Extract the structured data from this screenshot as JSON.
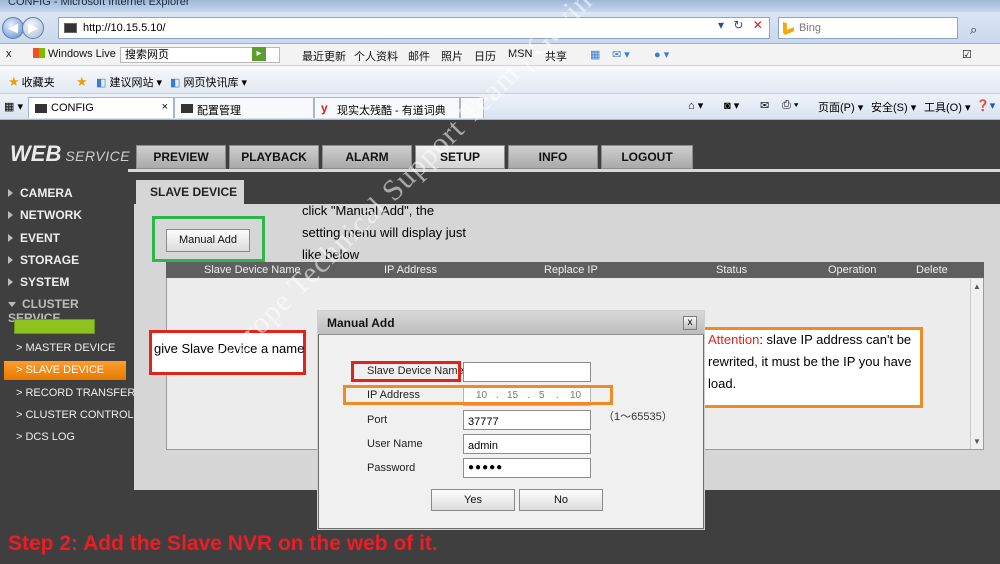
{
  "browser": {
    "window_title": "CONFIG - Microsoft Internet Explorer",
    "url": "http://10.15.5.10/",
    "search_placeholder": "Bing",
    "live_bar": {
      "close": "x",
      "windows_live": "Windows Live",
      "search_placeholder": "搜索网页",
      "links": [
        "最近更新",
        "个人资料",
        "邮件",
        "照片",
        "日历",
        "MSN",
        "共享"
      ]
    },
    "favorites": {
      "favorites_label": "收藏夹",
      "suggested_sites": "建议网站 ▾",
      "web_slices": "网页快讯库 ▾"
    },
    "tabs": [
      {
        "label": "CONFIG",
        "close": "×"
      },
      {
        "label": "配置管理"
      },
      {
        "label": "现实太残酷 - 有道词典"
      }
    ],
    "command_bar": {
      "page": "页面(P) ▾",
      "safety": "安全(S) ▾",
      "tools": "工具(O) ▾"
    }
  },
  "app": {
    "logo_main": "WEB",
    "logo_sub": "SERVICE",
    "top_tabs": [
      "PREVIEW",
      "PLAYBACK",
      "ALARM",
      "SETUP",
      "INFO",
      "LOGOUT"
    ],
    "active_top_tab": "SETUP",
    "side_menu": [
      "CAMERA",
      "NETWORK",
      "EVENT",
      "STORAGE",
      "SYSTEM"
    ],
    "cluster_service": "CLUSTER SERVICE",
    "cluster_submenu": [
      "> MASTER DEVICE",
      "> SLAVE DEVICE",
      "> RECORD TRANSFER",
      "> CLUSTER CONTROL",
      "> DCS LOG"
    ],
    "active_submenu": "> SLAVE DEVICE",
    "page_tab": "SLAVE DEVICE",
    "manual_add_button": "Manual Add",
    "table_columns": [
      "Slave Device Name",
      "IP Address",
      "Replace IP",
      "Status",
      "Operation",
      "Delete"
    ]
  },
  "annotations": {
    "manual_add_note": [
      "click \"Manual Add\", the",
      "setting menu will display just",
      "like below"
    ],
    "name_note": "give Slave Device a name",
    "attention_label": "Attention",
    "attention_text_1": ": slave IP address can't be",
    "attention_text_2": "rewrited, it must be the IP you have",
    "attention_text_3": "load.",
    "watermark": "Europe Technical Support Team | Gavin",
    "step": "Step 2: Add the Slave NVR on the web of it."
  },
  "dialog": {
    "title": "Manual Add",
    "close": "x",
    "fields": {
      "device_name_label": "Slave Device Name",
      "device_name_value": "",
      "ip_label": "IP Address",
      "ip_octets": [
        "10",
        "15",
        "5",
        "10"
      ],
      "port_label": "Port",
      "port_value": "37777",
      "port_range": "（1～65535）",
      "user_label": "User Name",
      "user_value": "admin",
      "password_label": "Password",
      "password_value": "●●●●●"
    },
    "yes_button": "Yes",
    "no_button": "No"
  },
  "colors": {
    "annotation_green": "#2fb54a",
    "annotation_red": "#e0241b",
    "annotation_orange": "#f08a24",
    "active_menu_orange": "#f28c1a",
    "cluster_green": "#8dc21f"
  }
}
